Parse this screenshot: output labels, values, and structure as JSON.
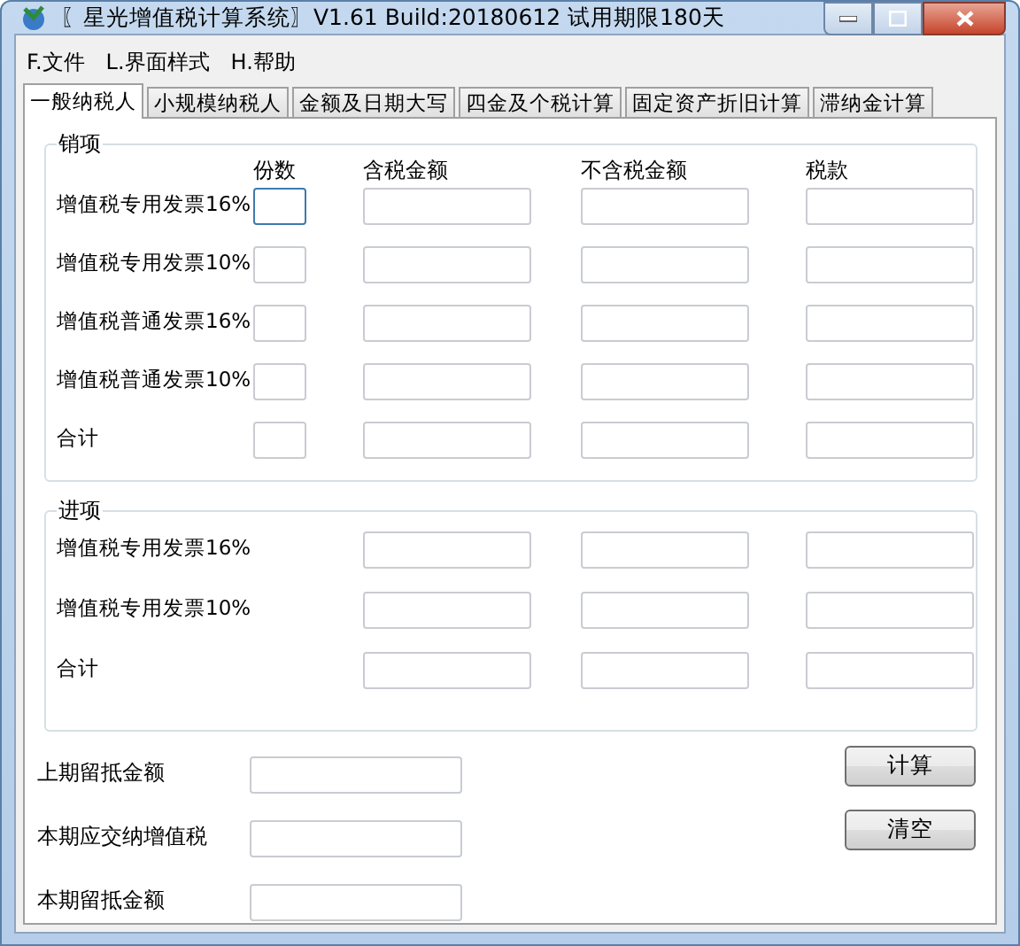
{
  "window": {
    "title": "〖星光增值税计算系统〗V1.61 Build:20180612 试用期限180天"
  },
  "menu": [
    "F.文件",
    "L.界面样式",
    "H.帮助"
  ],
  "tabs": [
    {
      "label": "一般纳税人",
      "selected": true
    },
    {
      "label": "小规模纳税人",
      "selected": false
    },
    {
      "label": "金额及日期大写",
      "selected": false
    },
    {
      "label": "四金及个税计算",
      "selected": false
    },
    {
      "label": "固定资产折旧计算",
      "selected": false
    },
    {
      "label": "滞纳金计算",
      "selected": false
    }
  ],
  "sales": {
    "title": "销项",
    "columns": [
      "份数",
      "含税金额",
      "不含税金额",
      "税款"
    ],
    "rows": [
      {
        "label": "增值税专用发票16%",
        "focused": true
      },
      {
        "label": "增值税专用发票10%",
        "focused": false
      },
      {
        "label": "增值税普通发票16%",
        "focused": false
      },
      {
        "label": "增值税普通发票10%",
        "focused": false
      },
      {
        "label": "合计",
        "focused": false
      }
    ]
  },
  "purchases": {
    "title": "进项",
    "rows": [
      {
        "label": "增值税专用发票16%"
      },
      {
        "label": "增值税专用发票10%"
      },
      {
        "label": "合计"
      }
    ]
  },
  "summary": [
    {
      "label": "上期留抵金额",
      "button": "计算"
    },
    {
      "label": "本期应交纳增值税",
      "button": "清空"
    },
    {
      "label": "本期留抵金额"
    }
  ]
}
